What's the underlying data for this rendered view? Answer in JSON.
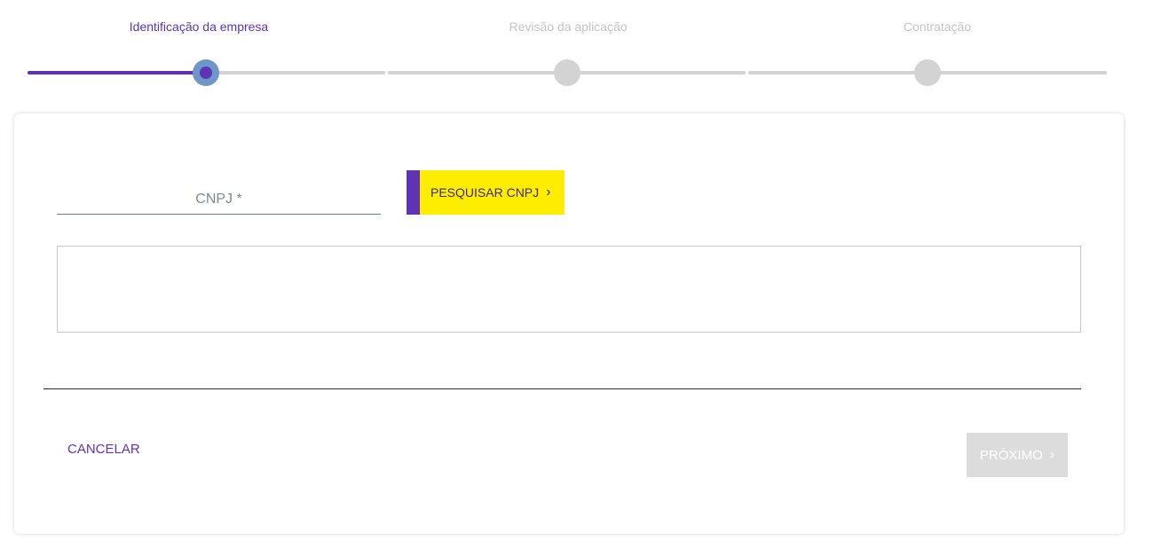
{
  "stepper": {
    "steps": [
      {
        "label": "Identificação da empresa",
        "state": "active"
      },
      {
        "label": "Revisão da aplicação",
        "state": "pending"
      },
      {
        "label": "Contratação",
        "state": "pending"
      }
    ]
  },
  "form": {
    "cnpj_label": "CNPJ *",
    "cnpj_value": "",
    "search_button_label": "PESQUISAR CNPJ",
    "search_button_icon": "chevron-right-icon"
  },
  "footer": {
    "cancel_label": "CANCELAR",
    "next_label": "PRÓXIMO",
    "next_icon": "chevron-right-icon",
    "next_disabled": true
  },
  "colors": {
    "primary": "#5f33b5",
    "accent": "#ffed00",
    "active_ring": "#6c97c8",
    "inactive": "#d3d3d3"
  }
}
